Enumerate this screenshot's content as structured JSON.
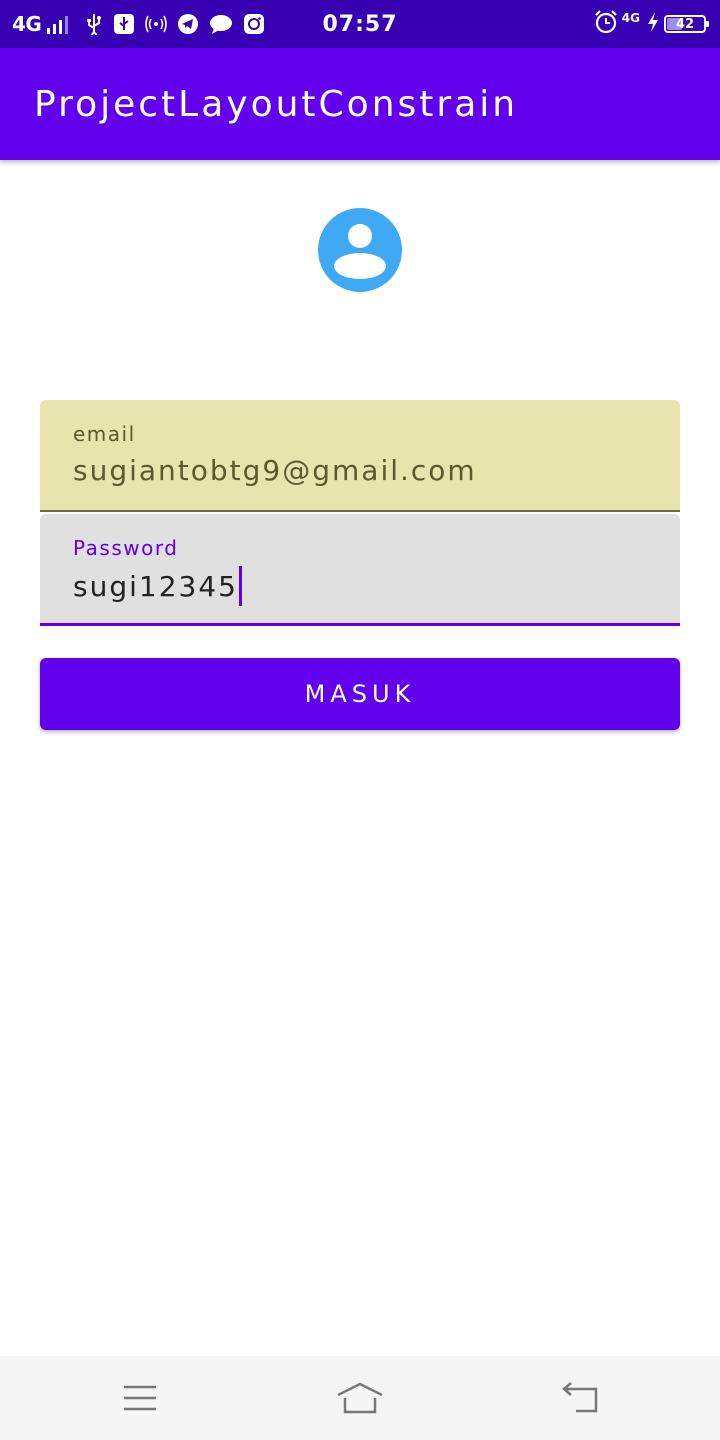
{
  "status_bar": {
    "network": "4G",
    "network_small": "4G",
    "time": "07:57",
    "battery": "42",
    "icons": [
      "signal-icon",
      "usb-icon",
      "usb-debug-icon",
      "hotspot-icon",
      "telegram-icon",
      "chat-icon",
      "instagram-icon",
      "alarm-icon",
      "charging-icon",
      "battery-icon"
    ]
  },
  "app_bar": {
    "title": "ProjectLayoutConstrain"
  },
  "avatar": {
    "icon": "account-circle-icon",
    "color": "#3fa9f5"
  },
  "form": {
    "email": {
      "label": "email",
      "value": "sugiantobtg9@gmail.com"
    },
    "password": {
      "label": "Password",
      "value": "sugi12345"
    },
    "submit_label": "MASUK"
  },
  "nav_bar": {
    "icons": [
      "menu-icon",
      "home-icon",
      "back-icon"
    ]
  },
  "colors": {
    "status_bar": "#3700b3",
    "primary": "#6200ee",
    "email_bg": "#e8e4ad",
    "password_bg": "#e0e0e0"
  }
}
